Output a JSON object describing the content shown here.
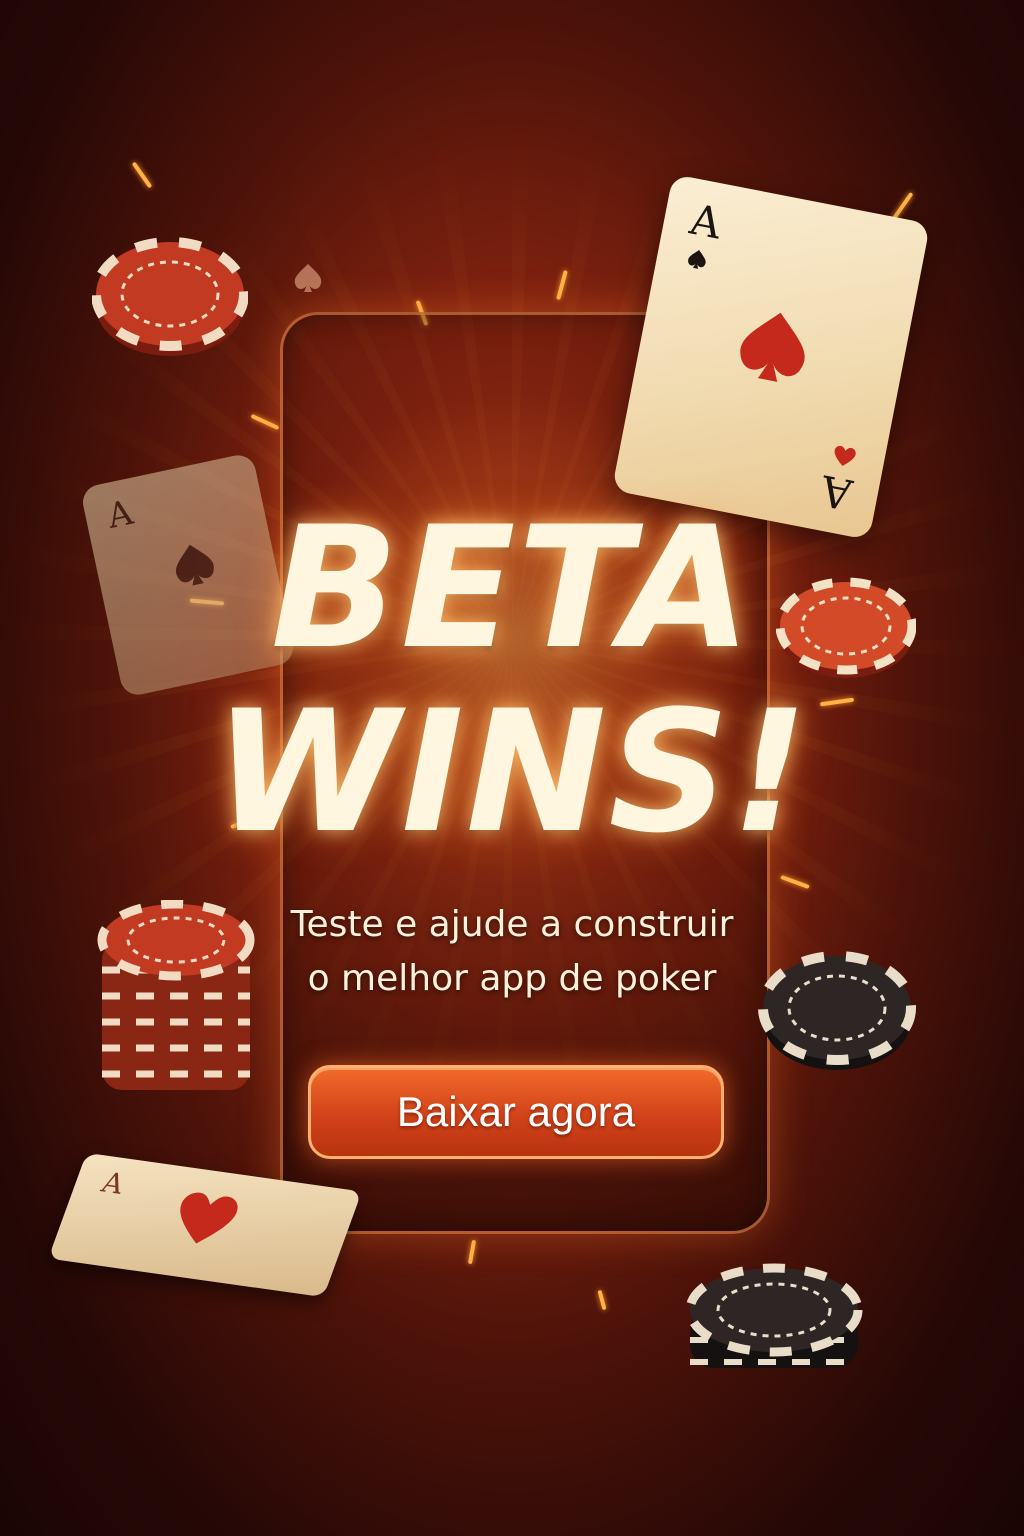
{
  "headline": {
    "line1": "BETA",
    "line2": "WINS!"
  },
  "subtitle": {
    "line1": "Teste e ajude a construir",
    "line2": "o melhor app de poker"
  },
  "cta": {
    "label": "Baixar agora"
  },
  "cards": {
    "rank": "A"
  },
  "colors": {
    "background_dark": "#260806",
    "background_glow": "#c9461c",
    "headline": "#fff6e0",
    "cta_fill": "#d2421a",
    "cta_border": "#ffb070",
    "chip_red": "#c23a22",
    "chip_dark": "#2e2624",
    "card_face": "#f3e2bf"
  },
  "decor_icons": [
    "poker-chip-icon",
    "playing-card-icon",
    "spade-icon",
    "heart-icon",
    "spark-icon"
  ]
}
